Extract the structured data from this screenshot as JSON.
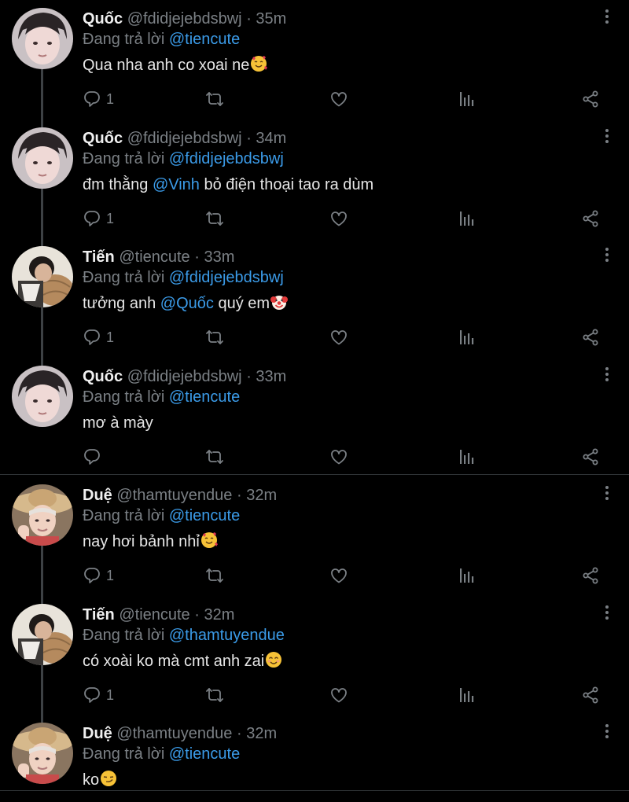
{
  "users": {
    "quoc": {
      "name": "Quốc",
      "handle": "@fdidjejebdsbwj"
    },
    "tien": {
      "name": "Tiến",
      "handle": "@tiencute"
    },
    "due": {
      "name": "Duệ",
      "handle": "@thamtuyendue"
    }
  },
  "reply_prefix": "Đang trả lời",
  "tweets": [
    {
      "name": "Quốc",
      "handle": "@fdidjejebdsbwj",
      "time": "· 35m",
      "reply_to": "@tiencute",
      "text_before": "Qua nha anh co xoai ne",
      "mention": "",
      "text_after": "",
      "emoji": "smiling-face-with-hearts",
      "reply_count": "1"
    },
    {
      "name": "Quốc",
      "handle": "@fdidjejebdsbwj",
      "time": "· 34m",
      "reply_to": "@fdidjejebdsbwj",
      "text_before": "đm thằng ",
      "mention": "@Vinh",
      "text_after": " bỏ điện thoại tao ra dùm",
      "emoji": "",
      "reply_count": "1"
    },
    {
      "name": "Tiến",
      "handle": "@tiencute",
      "time": "· 33m",
      "reply_to": "@fdidjejebdsbwj",
      "text_before": "tưởng anh ",
      "mention": "@Quốc",
      "text_after": " quý em",
      "emoji": "clown-face",
      "reply_count": "1"
    },
    {
      "name": "Quốc",
      "handle": "@fdidjejebdsbwj",
      "time": "· 33m",
      "reply_to": "@tiencute",
      "text_before": "mơ à mày",
      "mention": "",
      "text_after": "",
      "emoji": "",
      "reply_count": ""
    },
    {
      "name": "Duệ",
      "handle": "@thamtuyendue",
      "time": "· 32m",
      "reply_to": "@tiencute",
      "text_before": "nay hơi bảnh nhỉ",
      "mention": "",
      "text_after": "",
      "emoji": "smiling-face-with-hearts",
      "reply_count": "1"
    },
    {
      "name": "Tiến",
      "handle": "@tiencute",
      "time": "· 32m",
      "reply_to": "@thamtuyendue",
      "text_before": "có xoài ko mà cmt anh zai",
      "mention": "",
      "text_after": "",
      "emoji": "smiling-face-with-smiling-eyes",
      "reply_count": "1"
    },
    {
      "name": "Duệ",
      "handle": "@thamtuyendue",
      "time": "· 32m",
      "reply_to": "@tiencute",
      "text_before": "ko",
      "mention": "",
      "text_after": "",
      "emoji": "smirking-face",
      "reply_count": ""
    }
  ],
  "icons": {
    "reply": "reply-icon",
    "retweet": "retweet-icon",
    "like": "heart-icon",
    "analytics": "analytics-icon",
    "share": "share-icon",
    "more": "more-vertical-icon"
  },
  "colors": {
    "background": "#000000",
    "mention": "#3b9be8",
    "muted": "#7b8085",
    "thread_line": "#3d4144"
  }
}
